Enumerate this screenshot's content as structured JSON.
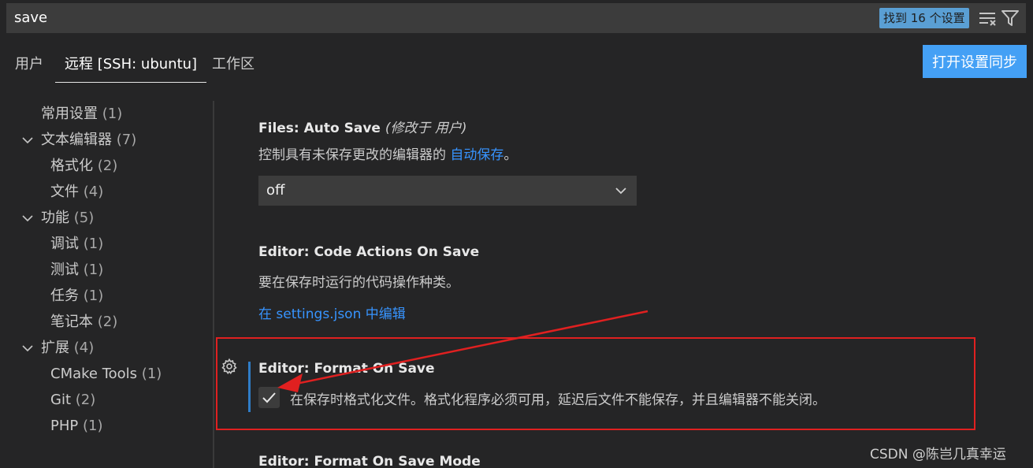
{
  "search": {
    "value": "save",
    "result_count": "找到 16 个设置"
  },
  "tabs": [
    {
      "label": "用户"
    },
    {
      "label": "远程 [SSH: ubuntu]"
    },
    {
      "label": "工作区"
    }
  ],
  "sync_button": "打开设置同步",
  "sidebar": {
    "items": [
      {
        "label": "常用设置",
        "count": "(1)"
      },
      {
        "label": "文本编辑器",
        "count": "(7)"
      },
      {
        "label": "格式化",
        "count": "(2)"
      },
      {
        "label": "文件",
        "count": "(4)"
      },
      {
        "label": "功能",
        "count": "(5)"
      },
      {
        "label": "调试",
        "count": "(1)"
      },
      {
        "label": "测试",
        "count": "(1)"
      },
      {
        "label": "任务",
        "count": "(1)"
      },
      {
        "label": "笔记本",
        "count": "(2)"
      },
      {
        "label": "扩展",
        "count": "(4)"
      },
      {
        "label": "CMake Tools",
        "count": "(1)"
      },
      {
        "label": "Git",
        "count": "(2)"
      },
      {
        "label": "PHP",
        "count": "(1)"
      }
    ]
  },
  "settings": {
    "auto_save": {
      "title": "Files: Auto Save",
      "modified": "(修改于 用户)",
      "desc_prefix": "控制具有未保存更改的编辑器的",
      "desc_link": "自动保存",
      "desc_suffix": "。",
      "value": "off"
    },
    "code_actions": {
      "title": "Editor: Code Actions On Save",
      "desc": "要在保存时运行的代码操作种类。",
      "link": "在 settings.json 中编辑"
    },
    "format_on_save": {
      "title": "Editor: Format On Save",
      "desc": "在保存时格式化文件。格式化程序必须可用，延迟后文件不能保存，并且编辑器不能关闭。",
      "checked": true
    },
    "format_on_save_mode": {
      "title": "Editor: Format On Save Mode"
    }
  },
  "watermark": "CSDN @陈岂几真幸运",
  "colors": {
    "accent": "#3794ff",
    "highlight": "#e02020",
    "background": "#252526"
  }
}
